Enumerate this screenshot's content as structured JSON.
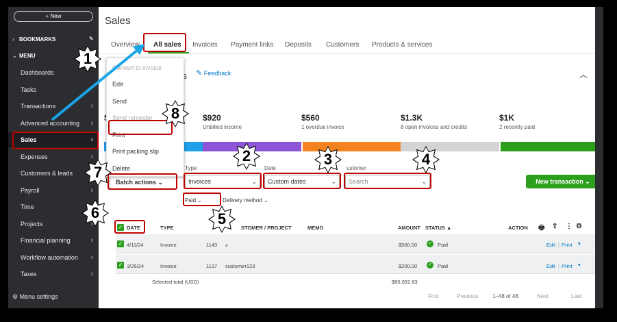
{
  "sidebar": {
    "new_label": "+ New",
    "bookmarks_label": "BOOKMARKS",
    "menu_label": "MENU",
    "items": [
      {
        "label": "Dashboards",
        "chevron": false
      },
      {
        "label": "Tasks",
        "chevron": false
      },
      {
        "label": "Transactions",
        "chevron": true
      },
      {
        "label": "Advanced accounting",
        "chevron": true
      },
      {
        "label": "Sales",
        "chevron": true
      },
      {
        "label": "Expenses",
        "chevron": true
      },
      {
        "label": "Customers & leads",
        "chevron": true
      },
      {
        "label": "Payroll",
        "chevron": true
      },
      {
        "label": "Time",
        "chevron": true
      },
      {
        "label": "Projects",
        "chevron": true
      },
      {
        "label": "Financial planning",
        "chevron": true
      },
      {
        "label": "Workflow automation",
        "chevron": true
      },
      {
        "label": "Taxes",
        "chevron": true
      }
    ],
    "menu_settings": "Menu settings"
  },
  "page": {
    "title": "Sales",
    "tabs": [
      "Overview",
      "All sales",
      "Invoices",
      "Payment links",
      "Deposits",
      "Customers",
      "Products & services"
    ],
    "section_title_fragment": "ons",
    "feedback": "Feedback"
  },
  "stats": [
    {
      "value": "$920",
      "label": "Unbilled income"
    },
    {
      "value": "$560",
      "label": "1 overdue invoice"
    },
    {
      "value": "$1.3K",
      "label": "8 open invoices and credits"
    },
    {
      "value": "$1K",
      "label": "2 recently paid"
    }
  ],
  "stat_first_fragment": "$",
  "colors": {
    "bar_blue": "#1e9fe8",
    "bar_purple": "#8d55d6",
    "bar_orange": "#f58220",
    "bar_gray": "#d4d4d4",
    "bar_green": "#2ca01c",
    "accent_green": "#2ca01c",
    "annotation_red": "#c00000",
    "arrow_blue": "#1aa3e8"
  },
  "filters": {
    "batch_actions": "Batch actions",
    "type_label": "Type",
    "type_value": "Invoices",
    "date_label": "Date",
    "date_value": "Custom dates",
    "customer_label": "ustomer",
    "search_placeholder": "Search",
    "new_transaction": "New transaction",
    "paid_chip": "Paid",
    "delivery_chip": "Delivery method"
  },
  "table": {
    "headers": {
      "date": "DATE",
      "type": "TYPE",
      "no": "NO.",
      "customer": "CUSTOMER / PROJECT",
      "customer_fragment": "STOMER / PROJECT",
      "memo": "MEMO",
      "amount": "AMOUNT",
      "status": "STATUS ▲",
      "action": "ACTION"
    },
    "rows": [
      {
        "date": "4/11/24",
        "type": "Invoice",
        "no": "1143",
        "customer": "z",
        "memo": "",
        "amount": "$500.00",
        "status": "Paid",
        "edit": "Edit",
        "print": "Print"
      },
      {
        "date": "3/25/24",
        "type": "Invoice",
        "no": "1137",
        "customer": "customer123",
        "memo": "",
        "amount": "$200.00",
        "status": "Paid",
        "edit": "Edit",
        "print": "Print"
      }
    ],
    "selected_total_label": "Selected total (USD)",
    "selected_total_value": "$80,092.83"
  },
  "pager": {
    "first": "First",
    "previous": "Previous",
    "range": "1–48 of 48",
    "next": "Next",
    "last": "Last"
  },
  "dropdown_menu": {
    "items": [
      {
        "label": "Convert to invoice",
        "disabled": true
      },
      {
        "label": "Edit",
        "disabled": false
      },
      {
        "label": "Send",
        "disabled": false
      },
      {
        "label": "Send reminder",
        "disabled": true
      },
      {
        "label": "Print",
        "disabled": false
      },
      {
        "label": "Print packing slip",
        "disabled": false
      },
      {
        "label": "Delete",
        "disabled": false
      }
    ]
  },
  "annotations": {
    "badges": [
      "1",
      "2",
      "3",
      "4",
      "5",
      "6",
      "7",
      "8"
    ]
  }
}
